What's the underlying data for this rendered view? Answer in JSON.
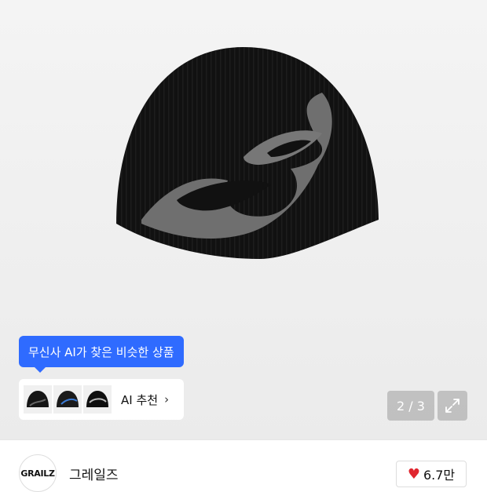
{
  "product": {
    "image_alt": "black knit beanie with grey flame graphic"
  },
  "ai_recommend": {
    "tooltip": "무신사 AI가 찾은 비슷한 상품",
    "label": "AI 추천",
    "chevron": "›",
    "thumbnails": [
      "beanie-thumbnail-1",
      "beanie-thumbnail-2",
      "beanie-thumbnail-3"
    ]
  },
  "gallery": {
    "counter": "2 / 3",
    "expand_icon": "expand-icon"
  },
  "brand": {
    "logo_text": "GRAILZ",
    "name": "그레일즈"
  },
  "likes": {
    "icon": "heart-icon",
    "count": "6.7만",
    "accent": "#e0262f"
  },
  "colors": {
    "tooltip_bg": "#2f6bff"
  }
}
